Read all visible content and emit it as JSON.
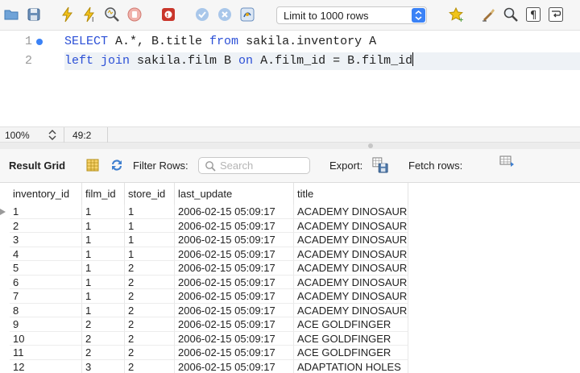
{
  "toolbar": {
    "icons": [
      "open-folder-icon",
      "save-icon",
      "execute-icon",
      "execute-current-icon",
      "explain-icon",
      "stop-icon",
      "toggle-error-icon",
      "commit-icon",
      "rollback-icon",
      "autocommit-icon",
      "bookmark-icon",
      "beautify-icon",
      "find-icon",
      "invisible-chars-icon",
      "word-wrap-icon"
    ],
    "limit_select": "Limit to 1000 rows"
  },
  "editor": {
    "lines": [
      {
        "number": "1",
        "parts": [
          "SELECT",
          " A.*, B.title ",
          "from",
          " sakila.inventory A"
        ]
      },
      {
        "number": "2",
        "parts": [
          "left join",
          " sakila.film B ",
          "on",
          " A.film_id = B.film_id"
        ]
      }
    ]
  },
  "status": {
    "zoom": "100%",
    "cursor": "49:2"
  },
  "results": {
    "title": "Result Grid",
    "filter_label": "Filter Rows:",
    "search_placeholder": "Search",
    "export_label": "Export:",
    "fetch_label": "Fetch rows:"
  },
  "grid": {
    "columns": [
      "inventory_id",
      "film_id",
      "store_id",
      "last_update",
      "title"
    ],
    "rows": [
      [
        "1",
        "1",
        "1",
        "2006-02-15 05:09:17",
        "ACADEMY DINOSAUR"
      ],
      [
        "2",
        "1",
        "1",
        "2006-02-15 05:09:17",
        "ACADEMY DINOSAUR"
      ],
      [
        "3",
        "1",
        "1",
        "2006-02-15 05:09:17",
        "ACADEMY DINOSAUR"
      ],
      [
        "4",
        "1",
        "1",
        "2006-02-15 05:09:17",
        "ACADEMY DINOSAUR"
      ],
      [
        "5",
        "1",
        "2",
        "2006-02-15 05:09:17",
        "ACADEMY DINOSAUR"
      ],
      [
        "6",
        "1",
        "2",
        "2006-02-15 05:09:17",
        "ACADEMY DINOSAUR"
      ],
      [
        "7",
        "1",
        "2",
        "2006-02-15 05:09:17",
        "ACADEMY DINOSAUR"
      ],
      [
        "8",
        "1",
        "2",
        "2006-02-15 05:09:17",
        "ACADEMY DINOSAUR"
      ],
      [
        "9",
        "2",
        "2",
        "2006-02-15 05:09:17",
        "ACE GOLDFINGER"
      ],
      [
        "10",
        "2",
        "2",
        "2006-02-15 05:09:17",
        "ACE GOLDFINGER"
      ],
      [
        "11",
        "2",
        "2",
        "2006-02-15 05:09:17",
        "ACE GOLDFINGER"
      ],
      [
        "12",
        "3",
        "2",
        "2006-02-15 05:09:17",
        "ADAPTATION HOLES"
      ]
    ]
  },
  "colors": {
    "keyword": "#2b4fd6",
    "accent": "#3b82f6",
    "current_line": "#eef2f6"
  }
}
